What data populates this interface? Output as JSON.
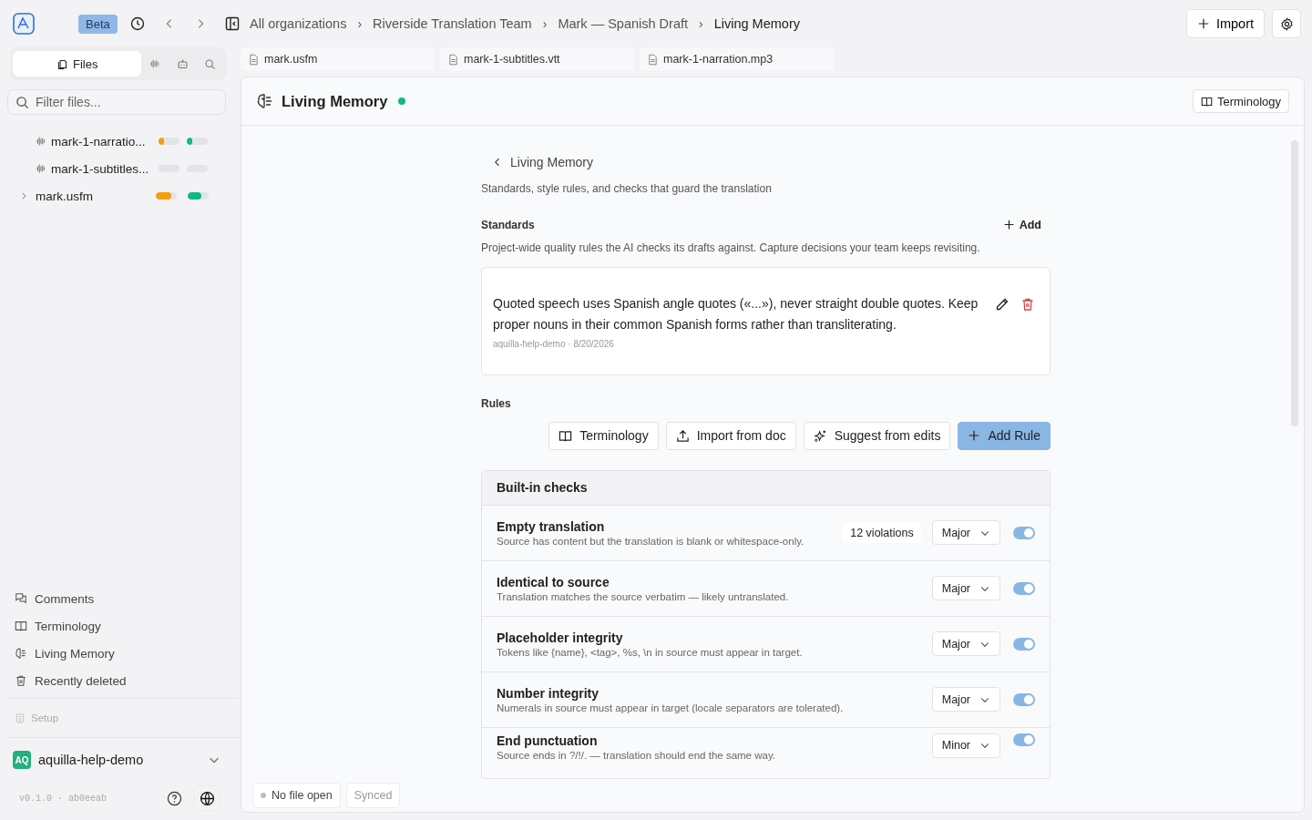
{
  "topbar": {
    "badge": "Beta",
    "separator": "›",
    "breadcrumb": [
      "All organizations",
      "Riverside Translation Team",
      "Mark — Spanish Draft",
      "Living Memory"
    ],
    "import_button": "Import"
  },
  "sidebar": {
    "tabs": [
      {
        "label": "Files",
        "selected": true
      },
      {
        "selected": false
      },
      {
        "selected": false
      },
      {
        "selected": false
      }
    ],
    "filter": {
      "placeholder": "Filter files..."
    },
    "files": [
      {
        "name": "mark-1-narratio...",
        "kind": "audio",
        "bars": [
          {
            "level": 0.26,
            "color": "#f59e0b"
          },
          {
            "level": 0.26,
            "color": "#10b981"
          }
        ]
      },
      {
        "name": "mark-1-subtitles...",
        "kind": "audio"
      },
      {
        "name": "mark.usfm",
        "kind": "folder",
        "bars": [
          {
            "level": 0.73,
            "color": "#f59e0b"
          },
          {
            "level": 0.67,
            "color": "#10b981"
          }
        ]
      }
    ],
    "nav": [
      "Comments",
      "Terminology",
      "Living Memory",
      "Recently deleted"
    ],
    "setup": {
      "label": "Setup",
      "disabled": true
    },
    "workspace": {
      "initials": "AQ",
      "name": "aquilla-help-demo"
    },
    "version": "v0.1.0 · ab0eeab"
  },
  "open_tabs": [
    "mark.usfm",
    "mark-1-subtitles.vtt",
    "mark-1-narration.mp3"
  ],
  "panel": {
    "title": "Living Memory",
    "online": true,
    "terminology_button": "Terminology"
  },
  "content": {
    "back": "Living Memory",
    "subtitle": "Standards, style rules, and checks that guard the translation",
    "standards": {
      "heading": "Standards",
      "add": "Add",
      "description": "Project-wide quality rules the AI checks its drafts against. Capture decisions your team keeps revisiting.",
      "items": [
        {
          "text": "Quoted speech uses Spanish angle quotes («...»), never straight double quotes. Keep proper nouns in their common Spanish forms rather than transliterating.",
          "meta": "aquilla-help-demo · 8/20/2026"
        }
      ]
    },
    "rules": {
      "heading": "Rules",
      "buttons": [
        {
          "label": "Terminology",
          "kind": "outline"
        },
        {
          "label": "Import from doc",
          "kind": "outline"
        },
        {
          "label": "Suggest from edits",
          "kind": "outline"
        },
        {
          "label": "Add Rule",
          "kind": "primary"
        }
      ]
    },
    "checks": {
      "heading": "Built-in checks",
      "items": [
        {
          "name": "Empty translation",
          "description": "Source has content but the translation is blank or whitespace-only.",
          "violations": "12 violations",
          "severity": "Major",
          "on": true
        },
        {
          "name": "Identical to source",
          "description": "Translation matches the source verbatim — likely untranslated.",
          "severity": "Major",
          "on": true
        },
        {
          "name": "Placeholder integrity",
          "description": "Tokens like {name}, <tag>, %s, \\n in source must appear in target.",
          "severity": "Major",
          "on": true
        },
        {
          "name": "Number integrity",
          "description": "Numerals in source must appear in target (locale separators are tolerated).",
          "severity": "Major",
          "on": true
        },
        {
          "name": "End punctuation",
          "description": "Source ends in ?/!/. — translation should end the same way.",
          "severity": "Minor",
          "on": true
        }
      ]
    }
  },
  "status": {
    "file": "No file open",
    "sync": "Synced"
  }
}
